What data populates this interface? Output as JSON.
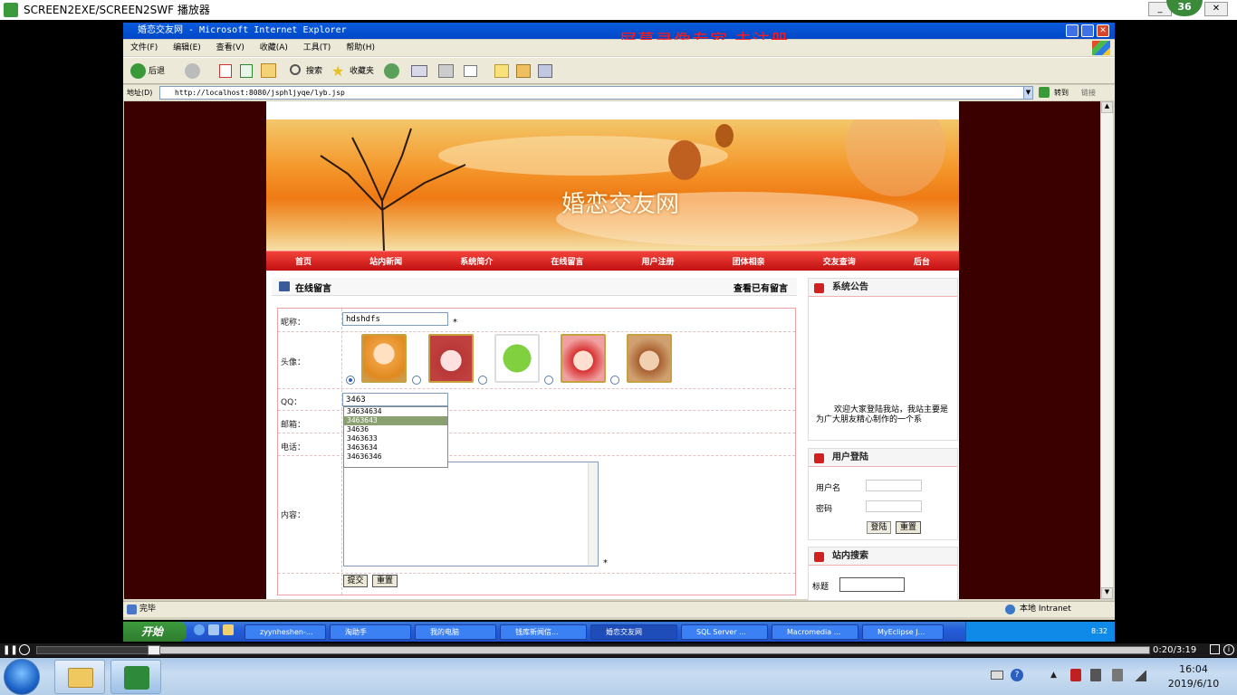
{
  "player": {
    "title": "SCREEN2EXE/SCREEN2SWF 播放器",
    "badge": "36",
    "time": "0:20/3:19",
    "watermark": "屏幕录像专家  未注册"
  },
  "ie": {
    "title": "婚恋交友网 - Microsoft Internet Explorer",
    "menu": [
      "文件(F)",
      "编辑(E)",
      "查看(V)",
      "收藏(A)",
      "工具(T)",
      "帮助(H)"
    ],
    "toolbar": {
      "back": "后退",
      "search": "搜索",
      "favorites": "收藏夹"
    },
    "address_label": "地址(D)",
    "address": "http://localhost:8080/jsphljyqe/lyb.jsp",
    "go": "转到",
    "links": "链接",
    "status_left": "完毕",
    "status_right": "本地 Intranet"
  },
  "site": {
    "banner_title": "婚恋交友网",
    "nav": [
      "首页",
      "站内新闻",
      "系统简介",
      "在线留言",
      "用户注册",
      "团体相亲",
      "交友查询",
      "后台"
    ],
    "section_title": "在线留言",
    "view_link": "查看已有留言",
    "form": {
      "nickname_label": "昵称：",
      "nickname_value": "hdshdfs",
      "avatar_label": "头像：",
      "qq_label": "QQ：",
      "qq_value": "3463",
      "email_label": "邮箱：",
      "phone_label": "电话：",
      "content_label": "内容：",
      "required": "*",
      "submit": "提交",
      "reset": "重置",
      "autocomplete": [
        "34634634",
        "3463643",
        "34636",
        "3463633",
        "3463634",
        "34636346"
      ]
    },
    "notice": {
      "title": "系统公告",
      "text": "欢迎大家登陆我站，我站主要是为广大朋友精心制作的一个系"
    },
    "login": {
      "title": "用户登陆",
      "username": "用户名",
      "password": "密码",
      "login_btn": "登陆",
      "reset_btn": "重置"
    },
    "search": {
      "title": "站内搜索",
      "label": "标题"
    }
  },
  "xp_taskbar": {
    "start": "开始",
    "tasks": [
      "zyynheshen-...",
      "淘助手",
      "我的电脑",
      "钱库新闻信...",
      "婚恋交友网",
      "SQL Server ...",
      "Macromedia ...",
      "MyEclipse J..."
    ],
    "clock": "8:32"
  },
  "win7": {
    "time": "16:04",
    "date": "2019/6/10"
  }
}
